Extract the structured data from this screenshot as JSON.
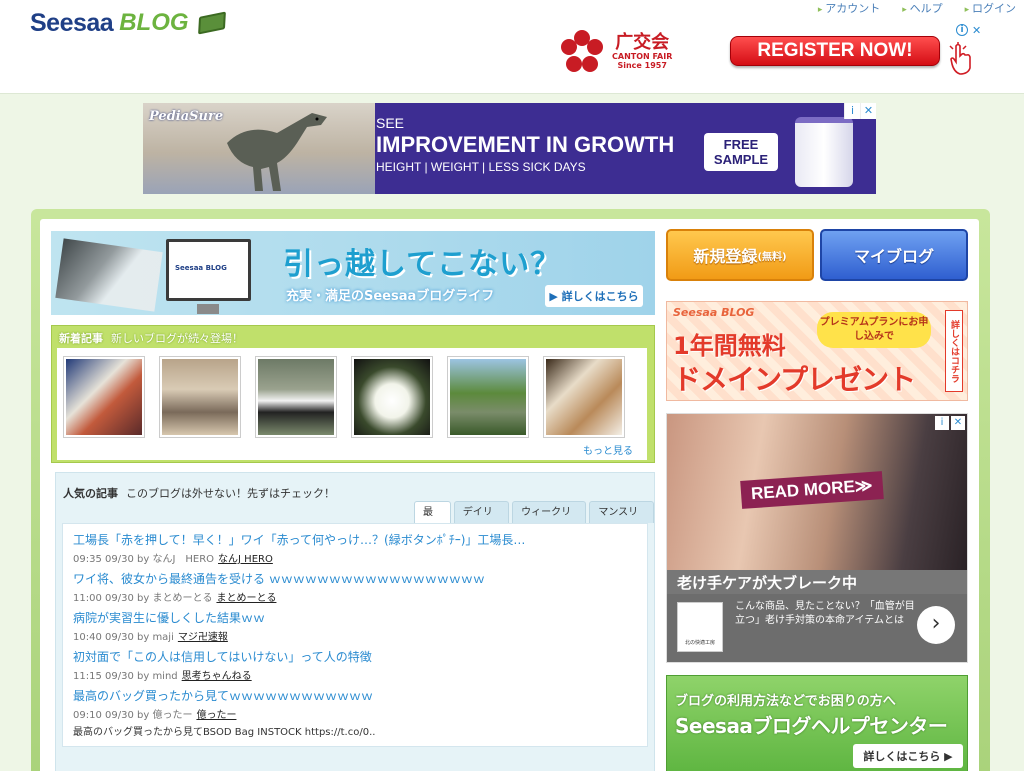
{
  "header": {
    "logo_text_1": "Seesaa",
    "logo_text_2": "BLOG",
    "links": [
      "アカウント",
      "ヘルプ",
      "ログイン"
    ],
    "ad": {
      "brand_cn": "广交会",
      "brand_en": "CANTON FAIR",
      "since": "Since 1957",
      "cta": "REGISTER NOW!",
      "info": "i",
      "close": "✕"
    }
  },
  "banner": {
    "brand": "PediaSure",
    "see": "SEE",
    "headline": "IMPROVEMENT IN GROWTH",
    "sub": "HEIGHT | WEIGHT | LESS SICK DAYS",
    "cta_line1": "FREE",
    "cta_line2": "SAMPLE",
    "info": "i",
    "close": "✕"
  },
  "hero": {
    "mini_logo": "Seesaa BLOG",
    "title": "引っ越してこない？",
    "subtitle": "充実・満足のSeesaaブログライフ",
    "button": "▶ 詳しくはこちら"
  },
  "new_articles": {
    "title": "新着記事",
    "subtitle": "新しいブログが続々登場！",
    "thumbs": [
      "food-photo",
      "gym-photo",
      "panda-photo",
      "flower-photo",
      "walkers-photo",
      "meal-photo"
    ],
    "more": "もっと見る"
  },
  "popular": {
    "title": "人気の記事",
    "subtitle": "このブログは外せない！先ずはチェック！",
    "tabs": [
      "最新",
      "デイリー",
      "ウィークリー",
      "マンスリー"
    ],
    "items": [
      {
        "title": "工場長「赤を押して！早く！」ワイ「赤って何やっけ…？(緑ボタンﾎﾟﾁｰ)」工場長…",
        "meta": "09:35 09/30 by なんJ　HERO",
        "blog": "なんJ HERO"
      },
      {
        "title": "ワイ将、彼女から最終通告を受ける ｗｗｗｗｗｗｗｗｗｗｗｗｗｗｗｗｗｗ",
        "meta": "11:00 09/30 by まとめーとる",
        "blog": "まとめーとる"
      },
      {
        "title": "病院が実習生に優しくした結果ｗｗ",
        "meta": "10:40 09/30 by maji",
        "blog": "マジ卍速報"
      },
      {
        "title": "初対面で「この人は信用してはいけない」って人の特徴",
        "meta": "11:15 09/30 by mind",
        "blog": "思考ちゃんねる"
      },
      {
        "title": "最高のバッグ買ったから見てｗｗｗｗｗｗｗｗｗｗｗｗ",
        "meta": "09:10 09/30 by 億ったー",
        "blog": "億ったー",
        "excerpt": "最高のバッグ買ったから見てBSOD Bag INSTOCK https://t.co/0.."
      }
    ]
  },
  "sidebar": {
    "register_label": "新規登録",
    "register_small": "(無料)",
    "myblog_label": "マイブログ",
    "premium": {
      "brand": "Seesaa BLOG",
      "pill": "プレミアムプランにお申し込みで",
      "line1": "1年間無料",
      "line2": "ドメインプレゼント",
      "side": "詳しくはコチラ"
    },
    "ad2": {
      "read_more": "READ MORE≫",
      "headline": "老け手ケアが大ブレーク中",
      "logo_text": "北の快適工房",
      "body": "こんな商品、見たことない？「血管が目立つ」老け手対策の本命アイテムとは",
      "next": "›",
      "info": "i",
      "close": "✕"
    },
    "help": {
      "line1": "ブログの利用方法などでお困りの方へ",
      "line2": "Seesaaブログヘルプセンター",
      "button": "詳しくはこちら ▶"
    }
  },
  "colors": {
    "accent_green": "#a9d27a",
    "link_blue": "#2a8bd0",
    "brand_navy": "#1f3f86"
  }
}
